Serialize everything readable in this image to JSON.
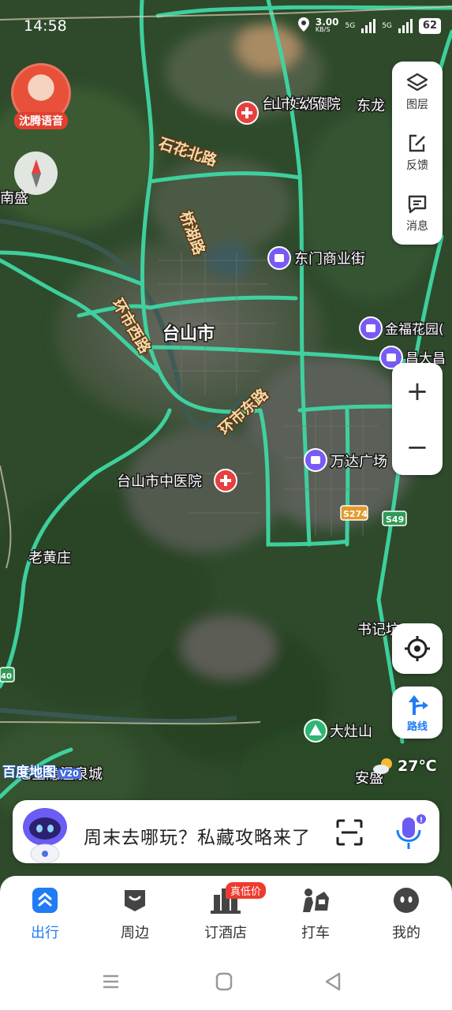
{
  "status_bar": {
    "time": "14:58",
    "speed": "3.00",
    "speed_unit": "KB/S",
    "network1": "5G",
    "network2": "5G",
    "battery": "62"
  },
  "voice_assistant": {
    "label": "沈腾语音"
  },
  "side_panel": {
    "layers_label": "图层",
    "feedback_label": "反馈",
    "messages_label": "消息"
  },
  "zoom": {
    "in_label": "+",
    "out_label": "−"
  },
  "route_button": {
    "label": "路线"
  },
  "weather": {
    "temperature": "27℃"
  },
  "map_logo": {
    "text": "百度地图",
    "version": "V20"
  },
  "map_labels": {
    "city": "台山市",
    "poi_maternal": "台山市妇幼保健院",
    "poi_dongmen": "东门商业街",
    "poi_jinfu": "金福花园(",
    "poi_changda": "昌大昌",
    "poi_wanda": "万达广场",
    "poi_tcm": "台山市中医院",
    "poi_dazaoshan": "大灶山",
    "road_shihua": "石花北路",
    "road_qiaohu": "桥湖路",
    "road_huanshi_west": "环市西路",
    "road_huanshi_east": "环市东路",
    "place_donglong": "东龙",
    "place_nansheng": "南盛",
    "place_laohuangzhuang": "老黄庄",
    "place_shujikeng": "书记坑",
    "place_ansheng": "安盛",
    "place_spring": "七宝隐温泉城",
    "shield_s274": "S274",
    "shield_s49": "S49",
    "shield_40": "40"
  },
  "search_bar": {
    "prompt": "周末去哪玩？私藏攻略来了"
  },
  "bottom_nav": {
    "items": [
      {
        "label": "出行"
      },
      {
        "label": "周边"
      },
      {
        "label": "订酒店"
      },
      {
        "label": "打车"
      },
      {
        "label": "我的"
      }
    ],
    "hotel_badge": "真低价"
  },
  "colors": {
    "accent": "#1f7cf5",
    "road": "#3fd7a4",
    "label_road": "#f6d9a6",
    "poi_purple": "#7a5af5",
    "poi_red": "#e84040",
    "badge": "#ee3b2d"
  }
}
